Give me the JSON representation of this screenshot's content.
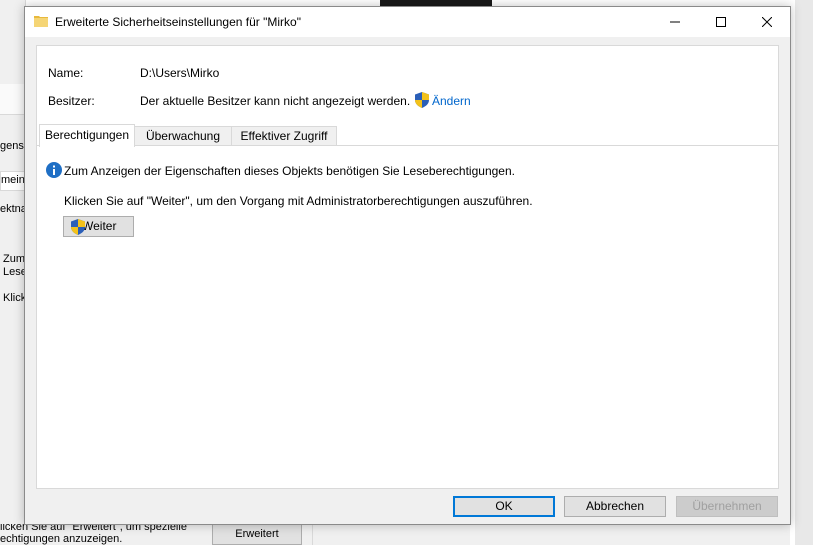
{
  "background": {
    "left_texts": [
      "gens",
      "mein",
      "ektna",
      "Zum",
      "Lese",
      "Klick"
    ],
    "bottom_texts": [
      "licken Sie auf \"Erweitert\", um spezielle",
      "echtigungen anzuzeigen."
    ],
    "erweitert_button": "Erweitert"
  },
  "dialog": {
    "title": "Erweiterte Sicherheitseinstellungen für \"Mirko\"",
    "name_label": "Name:",
    "name_value": "D:\\Users\\Mirko",
    "owner_label": "Besitzer:",
    "owner_value": "Der aktuelle Besitzer kann nicht angezeigt werden.",
    "change_link": "Ändern",
    "tabs": [
      {
        "label": "Berechtigungen",
        "active": true
      },
      {
        "label": "Überwachung",
        "active": false
      },
      {
        "label": "Effektiver Zugriff",
        "active": false
      }
    ],
    "info_message": "Zum Anzeigen der Eigenschaften dieses Objekts benötigen Sie Leseberechtigungen.",
    "continue_message": "Klicken Sie auf \"Weiter\", um den Vorgang mit Administratorberechtigungen auszuführen.",
    "continue_button": "Weiter",
    "buttons": {
      "ok": "OK",
      "cancel": "Abbrechen",
      "apply": "Übernehmen"
    }
  },
  "colors": {
    "link": "#0066cc",
    "focus": "#0078d7",
    "info": "#1f6fc5",
    "shield_blue": "#2b5fb8",
    "shield_yellow": "#f3c21b",
    "folder": "#f5d575"
  },
  "icons": [
    "folder-icon",
    "minimize-icon",
    "maximize-icon",
    "close-icon",
    "shield-icon",
    "info-icon"
  ]
}
